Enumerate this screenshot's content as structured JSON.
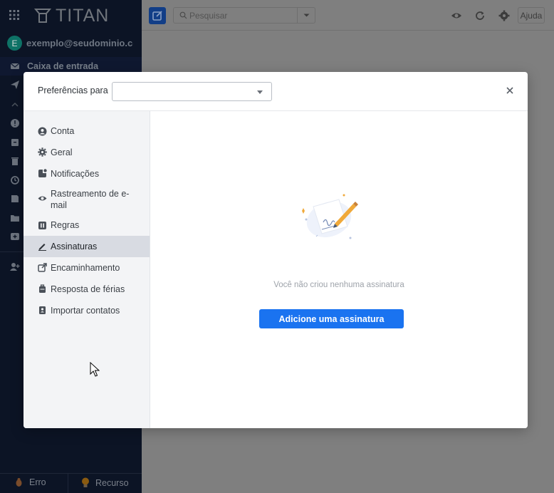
{
  "app": {
    "logo_text": "TITAN",
    "account_initial": "E",
    "account_email": "exemplo@seudominio.co...",
    "inbox_label": "Caixa de entrada",
    "bottom": {
      "error_label": "Erro",
      "feature_label": "Recurso"
    }
  },
  "topbar": {
    "search_placeholder": "Pesquisar",
    "help_label": "Ajuda"
  },
  "modal": {
    "pref_label": "Preferências para",
    "pref_value": "",
    "nav": [
      {
        "label": "Conta",
        "icon": "user-circle-icon"
      },
      {
        "label": "Geral",
        "icon": "gear-icon"
      },
      {
        "label": "Notificações",
        "icon": "notification-icon"
      },
      {
        "label": "Rastreamento de e-mail",
        "icon": "eye-icon"
      },
      {
        "label": "Regras",
        "icon": "rules-icon"
      },
      {
        "label": "Assinaturas",
        "icon": "pen-icon",
        "active": true
      },
      {
        "label": "Encaminhamento",
        "icon": "forward-icon"
      },
      {
        "label": "Resposta de férias",
        "icon": "suitcase-icon"
      },
      {
        "label": "Importar contatos",
        "icon": "contacts-icon"
      }
    ],
    "empty_text": "Você não criou nenhuma assinatura",
    "add_button": "Adicione uma assinatura"
  },
  "colors": {
    "sidebar": "#0c1425",
    "overlay_main": "#7f7f7f",
    "accent": "#1a73f0",
    "active_nav": "#d8dbe2"
  }
}
